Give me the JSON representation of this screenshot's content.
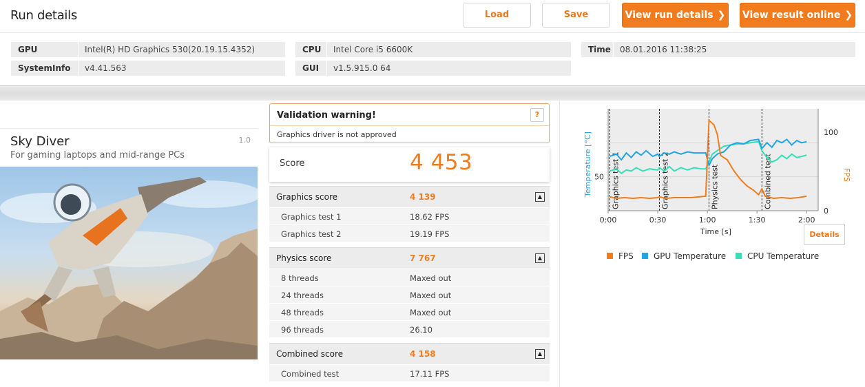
{
  "header": {
    "title": "Run details",
    "load_label": "Load",
    "save_label": "Save",
    "view_run_label": "View run details",
    "view_online_label": "View result online"
  },
  "info": {
    "gpu_key": "GPU",
    "gpu_val": "Intel(R) HD Graphics 530(20.19.15.4352)",
    "sysinfo_key": "SystemInfo",
    "sysinfo_val": "v4.41.563",
    "cpu_key": "CPU",
    "cpu_val": "Intel Core i5 6600K",
    "gui_key": "GUI",
    "gui_val": "v1.5.915.0 64",
    "time_key": "Time",
    "time_val": "08.01.2016 11:38:25"
  },
  "benchmark": {
    "title": "Sky Diver",
    "subtitle": "For gaming laptops and mid-range PCs",
    "version": "1.0"
  },
  "warning": {
    "title": "Validation warning!",
    "help": "?",
    "text": "Graphics driver is not approved"
  },
  "score": {
    "label": "Score",
    "value": "4 453"
  },
  "sections": {
    "graphics": {
      "name": "Graphics score",
      "value": "4 139",
      "rows": [
        {
          "name": "Graphics test 1",
          "value": "18.62 FPS"
        },
        {
          "name": "Graphics test 2",
          "value": "19.19 FPS"
        }
      ]
    },
    "physics": {
      "name": "Physics score",
      "value": "7 767",
      "rows": [
        {
          "name": "8 threads",
          "value": "Maxed out"
        },
        {
          "name": "24 threads",
          "value": "Maxed out"
        },
        {
          "name": "48 threads",
          "value": "Maxed out"
        },
        {
          "name": "96 threads",
          "value": "26.10"
        }
      ]
    },
    "combined": {
      "name": "Combined score",
      "value": "4 158",
      "rows": [
        {
          "name": "Combined test",
          "value": "17.11 FPS"
        }
      ]
    }
  },
  "chart_data": {
    "type": "line",
    "xlabel": "Time [s]",
    "ylabel_left": "Temperature [°C]",
    "ylabel_right": "FPS",
    "xticks": [
      "0:00",
      "0:30",
      "1:00",
      "1:30",
      "2:00"
    ],
    "yticks_left": [
      "50"
    ],
    "yticks_right": [
      "100",
      "0"
    ],
    "sections": [
      "Graphics test 1",
      "Graphics test 2",
      "Physics test",
      "Combined test"
    ],
    "section_starts": [
      1,
      31,
      61,
      93
    ],
    "legend": [
      "FPS",
      "GPU Temperature",
      "CPU Temperature"
    ],
    "colors": {
      "FPS": "#f07c1c",
      "GPU Temperature": "#1ea6e0",
      "CPU Temperature": "#34e0b8"
    },
    "fps": [
      [
        1,
        19
      ],
      [
        5,
        17
      ],
      [
        10,
        18
      ],
      [
        15,
        17
      ],
      [
        20,
        18
      ],
      [
        25,
        17
      ],
      [
        30,
        18
      ],
      [
        31,
        19
      ],
      [
        35,
        17
      ],
      [
        40,
        18
      ],
      [
        45,
        18
      ],
      [
        50,
        18
      ],
      [
        55,
        19
      ],
      [
        59,
        20
      ],
      [
        61,
        124
      ],
      [
        64,
        118
      ],
      [
        66,
        105
      ],
      [
        68,
        76
      ],
      [
        72,
        70
      ],
      [
        76,
        55
      ],
      [
        80,
        43
      ],
      [
        84,
        34
      ],
      [
        88,
        28
      ],
      [
        91,
        22
      ],
      [
        93,
        30
      ],
      [
        95,
        20
      ],
      [
        100,
        17
      ],
      [
        105,
        18
      ],
      [
        110,
        17
      ],
      [
        115,
        18
      ],
      [
        120,
        20
      ]
    ],
    "gpu_temperature": [
      [
        1,
        68
      ],
      [
        5,
        70
      ],
      [
        8,
        65
      ],
      [
        11,
        71
      ],
      [
        14,
        67
      ],
      [
        17,
        72
      ],
      [
        20,
        69
      ],
      [
        23,
        73
      ],
      [
        27,
        68
      ],
      [
        30,
        70
      ],
      [
        31,
        68
      ],
      [
        34,
        71
      ],
      [
        37,
        70
      ],
      [
        40,
        72
      ],
      [
        44,
        70
      ],
      [
        48,
        72
      ],
      [
        52,
        71
      ],
      [
        56,
        71
      ],
      [
        59,
        71
      ],
      [
        61,
        60
      ],
      [
        63,
        66
      ],
      [
        66,
        70
      ],
      [
        70,
        72
      ],
      [
        74,
        78
      ],
      [
        78,
        80
      ],
      [
        82,
        79
      ],
      [
        86,
        82
      ],
      [
        91,
        83
      ],
      [
        93,
        75
      ],
      [
        96,
        80
      ],
      [
        99,
        76
      ],
      [
        102,
        82
      ],
      [
        105,
        80
      ],
      [
        108,
        83
      ],
      [
        111,
        78
      ],
      [
        114,
        82
      ],
      [
        117,
        80
      ],
      [
        120,
        81
      ]
    ],
    "cpu_temperature": [
      [
        1,
        55
      ],
      [
        5,
        57
      ],
      [
        8,
        53
      ],
      [
        11,
        56
      ],
      [
        14,
        55
      ],
      [
        17,
        58
      ],
      [
        21,
        55
      ],
      [
        25,
        57
      ],
      [
        30,
        56
      ],
      [
        31,
        58
      ],
      [
        34,
        55
      ],
      [
        37,
        59
      ],
      [
        40,
        55
      ],
      [
        44,
        58
      ],
      [
        48,
        56
      ],
      [
        52,
        58
      ],
      [
        56,
        57
      ],
      [
        59,
        57
      ],
      [
        61,
        63
      ],
      [
        63,
        70
      ],
      [
        66,
        73
      ],
      [
        70,
        77
      ],
      [
        74,
        78
      ],
      [
        78,
        79
      ],
      [
        82,
        79
      ],
      [
        86,
        80
      ],
      [
        91,
        81
      ],
      [
        93,
        73
      ],
      [
        96,
        67
      ],
      [
        99,
        63
      ],
      [
        102,
        65
      ],
      [
        105,
        69
      ],
      [
        108,
        66
      ],
      [
        111,
        70
      ],
      [
        114,
        67
      ],
      [
        117,
        68
      ],
      [
        120,
        69
      ]
    ]
  },
  "chart_ui": {
    "details_label": "Details"
  }
}
